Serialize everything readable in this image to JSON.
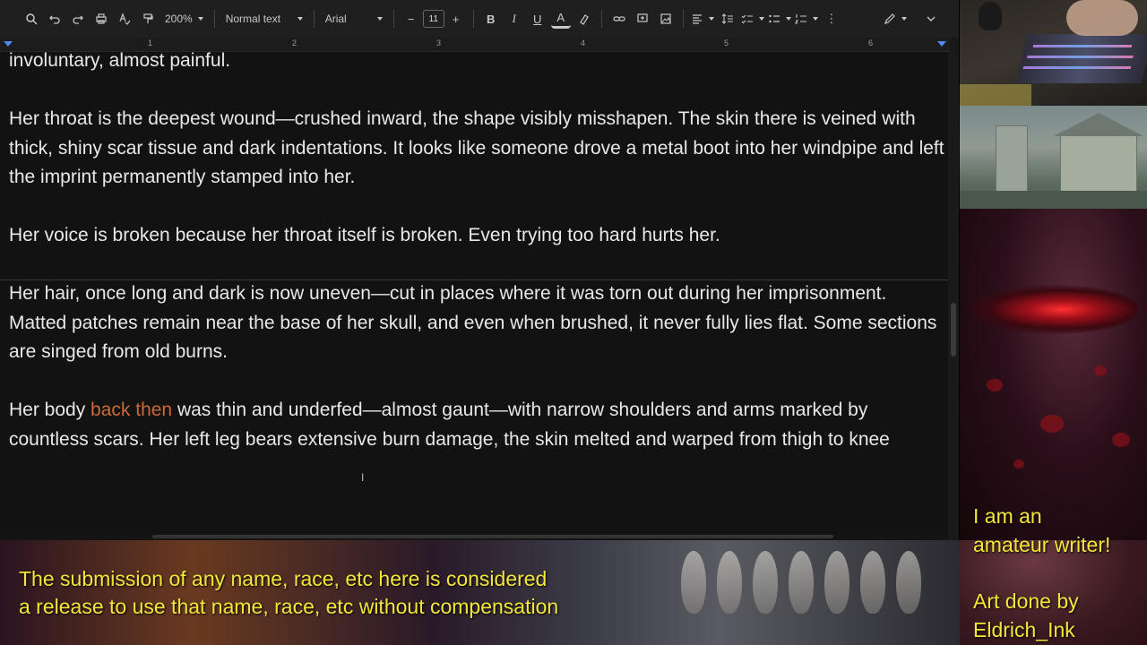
{
  "toolbar": {
    "zoom": "200%",
    "style": "Normal text",
    "font": "Arial",
    "font_size": "11",
    "icons": [
      "search-icon",
      "undo-icon",
      "redo-icon",
      "print-icon",
      "spellcheck-icon",
      "paint-format-icon",
      "minus-icon",
      "plus-icon",
      "bold-icon",
      "italic-icon",
      "underline-icon",
      "text-color-icon",
      "highlight-icon",
      "link-icon",
      "comment-icon",
      "image-icon",
      "align-icon",
      "line-spacing-icon",
      "checklist-icon",
      "bullet-list-icon",
      "numbered-list-icon",
      "more-icon",
      "edit-pen-icon",
      "collapse-icon"
    ],
    "bold": "B",
    "italic": "I",
    "underline": "U",
    "text_color": "A"
  },
  "ruler": {
    "numbers": [
      "1",
      "2",
      "3",
      "4",
      "5",
      "6"
    ]
  },
  "document": {
    "para1": "involuntary, almost painful.",
    "para2": "Her throat is the deepest wound—crushed inward, the shape visibly misshapen. The skin there is veined with thick, shiny scar tissue and dark indentations. It looks like someone drove a metal boot into her windpipe and left the imprint permanently stamped into her.",
    "para3": "Her voice is broken because her throat itself is broken. Even trying too hard hurts her.",
    "para4": "Her hair, once long and dark is now uneven—cut in places where it was torn out during her imprisonment. Matted patches remain near the base of her skull, and even when brushed, it never fully lies flat. Some sections are singed from old burns.",
    "para5_before": "Her body ",
    "para5_highlight": "back then",
    "para5_after": " was thin and underfed—almost gaunt—with narrow shoulders and arms marked by countless scars. Her left leg bears extensive burn damage, the skin melted and warped from thigh to knee",
    "highlight_color": "#c8693a"
  },
  "overlay": {
    "disclaimer_line1": "The submission of any name, race, etc here is considered",
    "disclaimer_line2": "a release to use that name, race, etc without compensation",
    "side_line1": "I am an",
    "side_line2": "amateur writer!",
    "side_line3": "Art done by",
    "side_line4": "Eldrich_Ink",
    "text_color": "#f2e63a"
  }
}
